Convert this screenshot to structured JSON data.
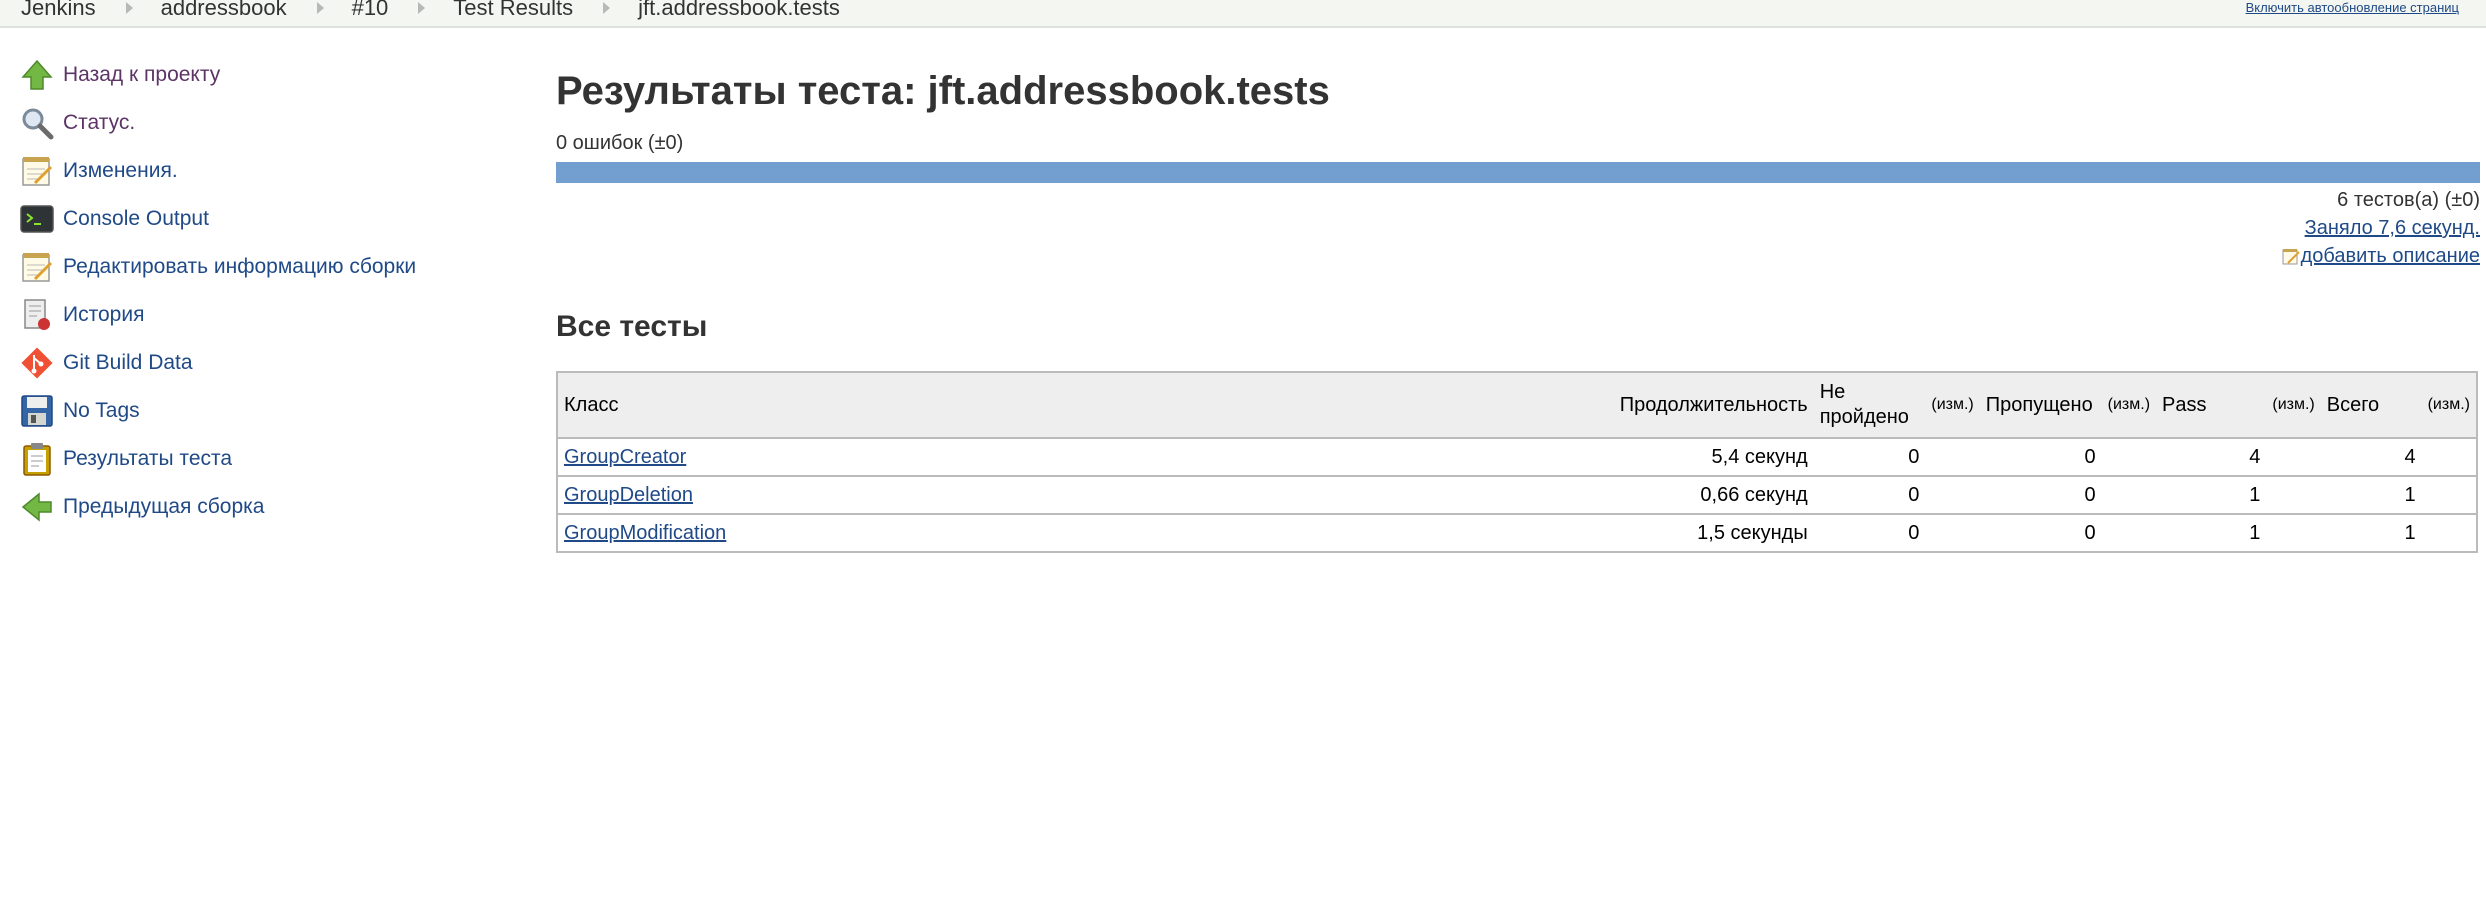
{
  "breadcrumbs": [
    "Jenkins",
    "addressbook",
    "#10",
    "Test Results",
    "jft.addressbook.tests"
  ],
  "auto_refresh_label": "Включить автообновление страниц",
  "sidebar": {
    "items": [
      {
        "label": "Назад к проекту",
        "icon": "up-arrow-icon"
      },
      {
        "label": "Статус.",
        "icon": "magnifier-icon"
      },
      {
        "label": "Изменения.",
        "icon": "notepad-icon"
      },
      {
        "label": "Console Output",
        "icon": "terminal-icon"
      },
      {
        "label": "Редактировать информацию сборки",
        "icon": "notepad-icon"
      },
      {
        "label": "История",
        "icon": "history-icon"
      },
      {
        "label": "Git Build Data",
        "icon": "git-icon"
      },
      {
        "label": "No Tags",
        "icon": "floppy-icon"
      },
      {
        "label": "Результаты теста",
        "icon": "clipboard-icon"
      },
      {
        "label": "Предыдущая сборка",
        "icon": "left-arrow-icon"
      }
    ]
  },
  "main": {
    "title": "Результаты теста: jft.addressbook.tests",
    "failures": "0 ошибок (±0)",
    "pass_fraction": 1.0,
    "tests_count": "6 тестов(а) (±0)",
    "took": "Заняло 7,6 секунд.",
    "add_description": "добавить описание",
    "all_tests_heading": "Все тесты"
  },
  "table": {
    "headers": {
      "class": "Класс",
      "duration": "Продолжительность",
      "failed": "Не пройдено",
      "diff": "(изм.)",
      "skipped": "Пропущено",
      "pass": "Pass",
      "total": "Всего"
    },
    "rows": [
      {
        "name": "GroupCreator",
        "duration": "5,4 секунд",
        "failed": "0",
        "skipped": "0",
        "pass": "4",
        "total": "4"
      },
      {
        "name": "GroupDeletion",
        "duration": "0,66 секунд",
        "failed": "0",
        "skipped": "0",
        "pass": "1",
        "total": "1"
      },
      {
        "name": "GroupModification",
        "duration": "1,5 секунды",
        "failed": "0",
        "skipped": "0",
        "pass": "1",
        "total": "1"
      }
    ]
  },
  "colors": {
    "link": "#204a87",
    "visited": "#5c3566",
    "pass_bar": "#729fcf",
    "header_bg": "#eeeeee"
  }
}
